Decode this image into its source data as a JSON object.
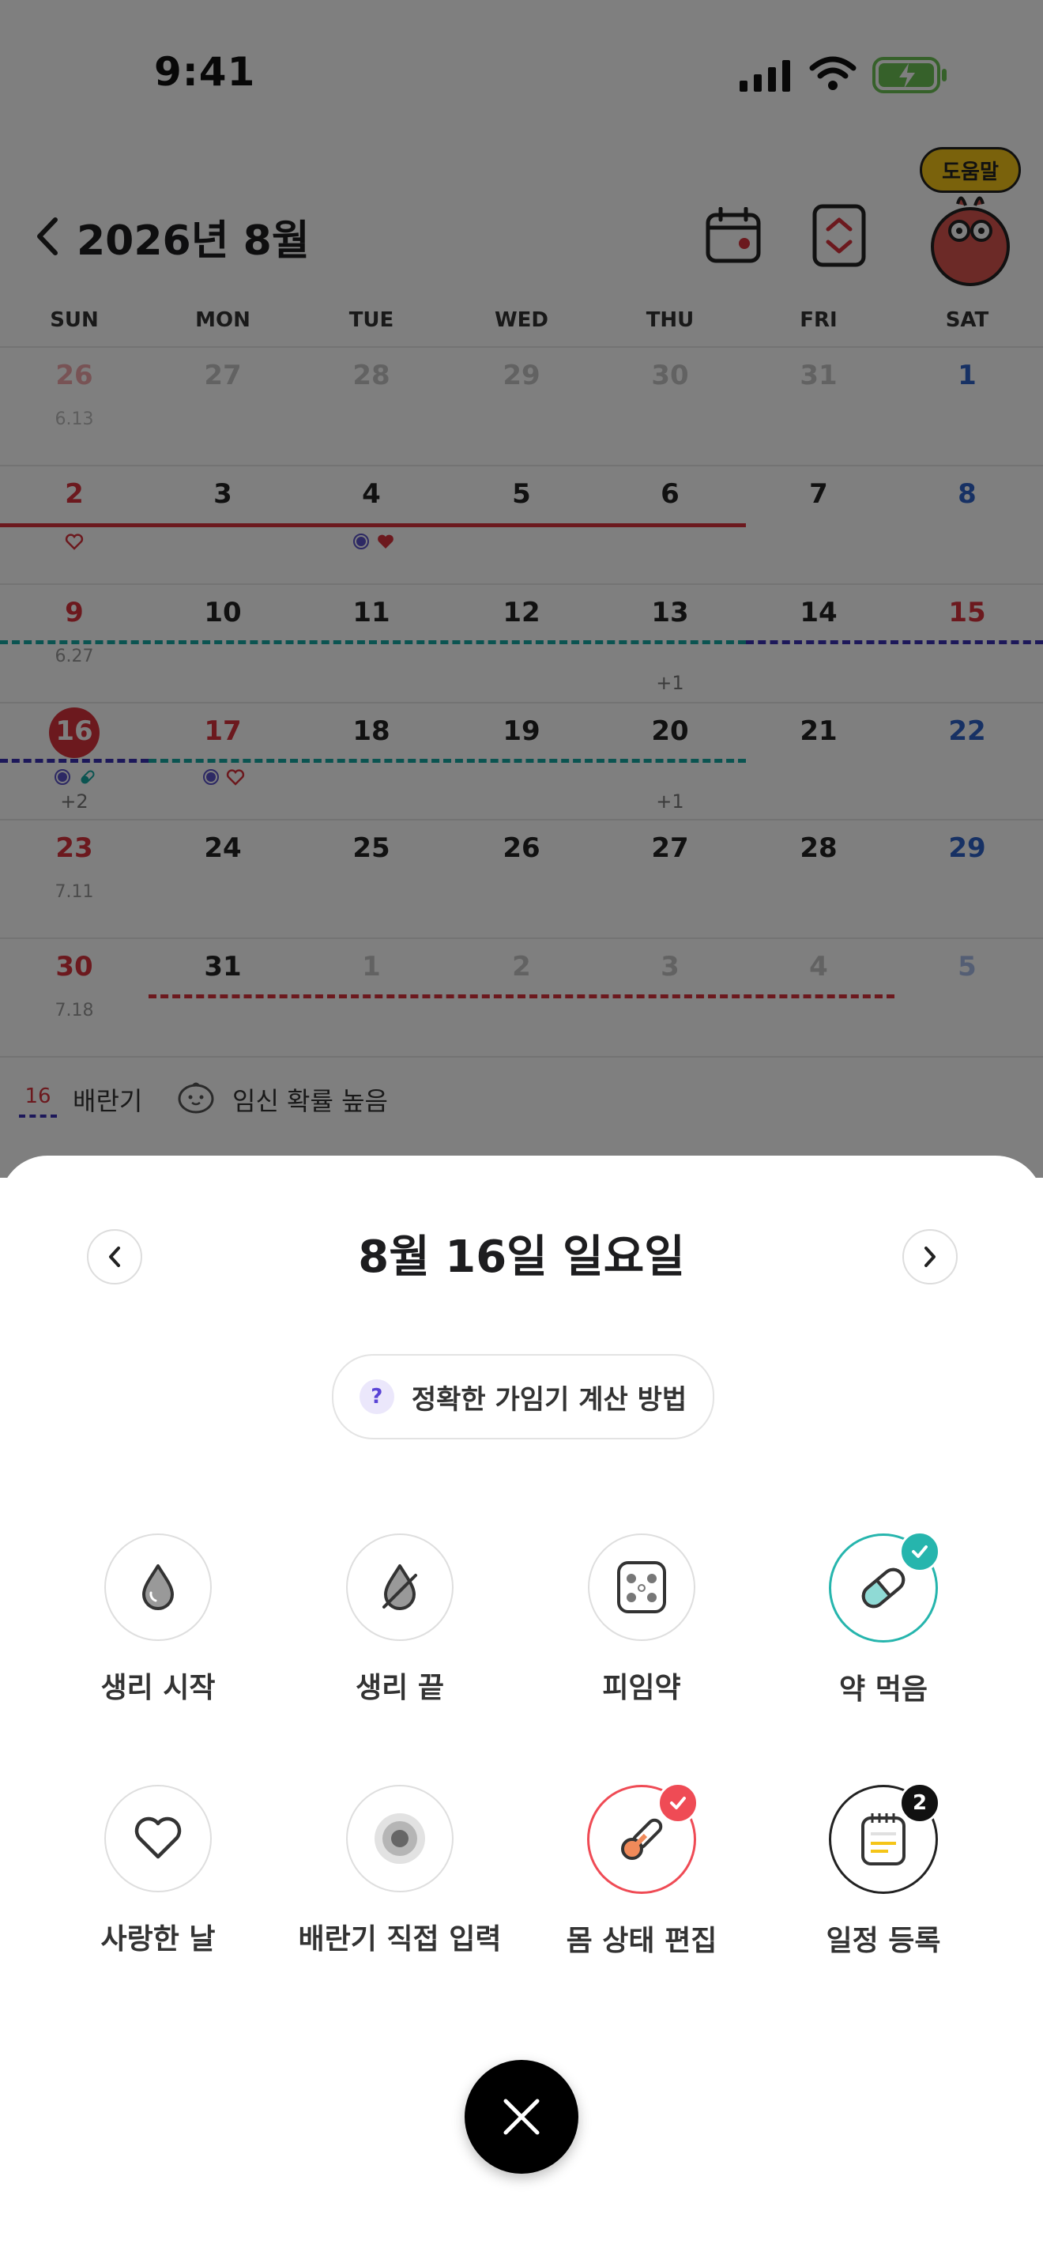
{
  "status_bar": {
    "time": "9:41"
  },
  "header": {
    "back_icon": "chevron-left-icon",
    "title": "2026년 8월",
    "help_bubble": "도움말"
  },
  "weekdays": [
    "SUN",
    "MON",
    "TUE",
    "WED",
    "THU",
    "FRI",
    "SAT"
  ],
  "calendar_rows": [
    {
      "days": [
        "26",
        "27",
        "28",
        "29",
        "30",
        "31",
        "1"
      ],
      "subs": [
        "6.13",
        "",
        "",
        "",
        "",
        "",
        ""
      ],
      "more": [
        "",
        "",
        "",
        "",
        "",
        "",
        ""
      ]
    },
    {
      "days": [
        "2",
        "3",
        "4",
        "5",
        "6",
        "7",
        "8"
      ],
      "subs": [
        "",
        "",
        "",
        "",
        "",
        "",
        ""
      ],
      "more": [
        "",
        "",
        "",
        "",
        "",
        "",
        ""
      ]
    },
    {
      "days": [
        "9",
        "10",
        "11",
        "12",
        "13",
        "14",
        "15"
      ],
      "subs": [
        "6.27",
        "",
        "",
        "",
        "",
        "",
        ""
      ],
      "more": [
        "",
        "",
        "",
        "",
        "+1",
        "",
        ""
      ]
    },
    {
      "days": [
        "16",
        "17",
        "18",
        "19",
        "20",
        "21",
        "22"
      ],
      "subs": [
        "",
        "",
        "",
        "",
        "",
        "",
        ""
      ],
      "more": [
        "+2",
        "",
        "",
        "",
        "+1",
        "",
        ""
      ]
    },
    {
      "days": [
        "23",
        "24",
        "25",
        "26",
        "27",
        "28",
        "29"
      ],
      "subs": [
        "7.11",
        "",
        "",
        "",
        "",
        "",
        ""
      ],
      "more": [
        "",
        "",
        "",
        "",
        "",
        "",
        ""
      ]
    },
    {
      "days": [
        "30",
        "31",
        "1",
        "2",
        "3",
        "4",
        "5"
      ],
      "subs": [
        "7.18",
        "",
        "",
        "",
        "",
        "",
        ""
      ],
      "more": [
        "",
        "",
        "",
        "",
        "",
        "",
        ""
      ]
    }
  ],
  "legend": {
    "sample_day": "16",
    "ovulation_label": "배란기",
    "pregnancy_label": "임신 확률 높음"
  },
  "sheet": {
    "title": "8월 16일 일요일",
    "info_pill": "정확한 가임기 계산 방법",
    "actions": [
      {
        "label": "생리 시작",
        "icon": "drop-icon"
      },
      {
        "label": "생리 끝",
        "icon": "drop-slash-icon"
      },
      {
        "label": "피임약",
        "icon": "pill-pack-icon"
      },
      {
        "label": "약 먹음",
        "icon": "capsule-icon",
        "state": "checked"
      },
      {
        "label": "사랑한 날",
        "icon": "heart-icon"
      },
      {
        "label": "배란기 직접 입력",
        "icon": "ovulation-icon"
      },
      {
        "label": "몸 상태 편집",
        "icon": "thermometer-icon",
        "state": "checked"
      },
      {
        "label": "일정 등록",
        "icon": "notepad-icon",
        "badge": "2"
      }
    ]
  },
  "colors": {
    "period_red": "#d8323c",
    "fertile_teal": "#16a8a3",
    "ovulation_purple": "#3b31b4",
    "saturday_blue": "#2f63c8",
    "check_teal": "#26b5ad",
    "check_red": "#ef4b55"
  }
}
